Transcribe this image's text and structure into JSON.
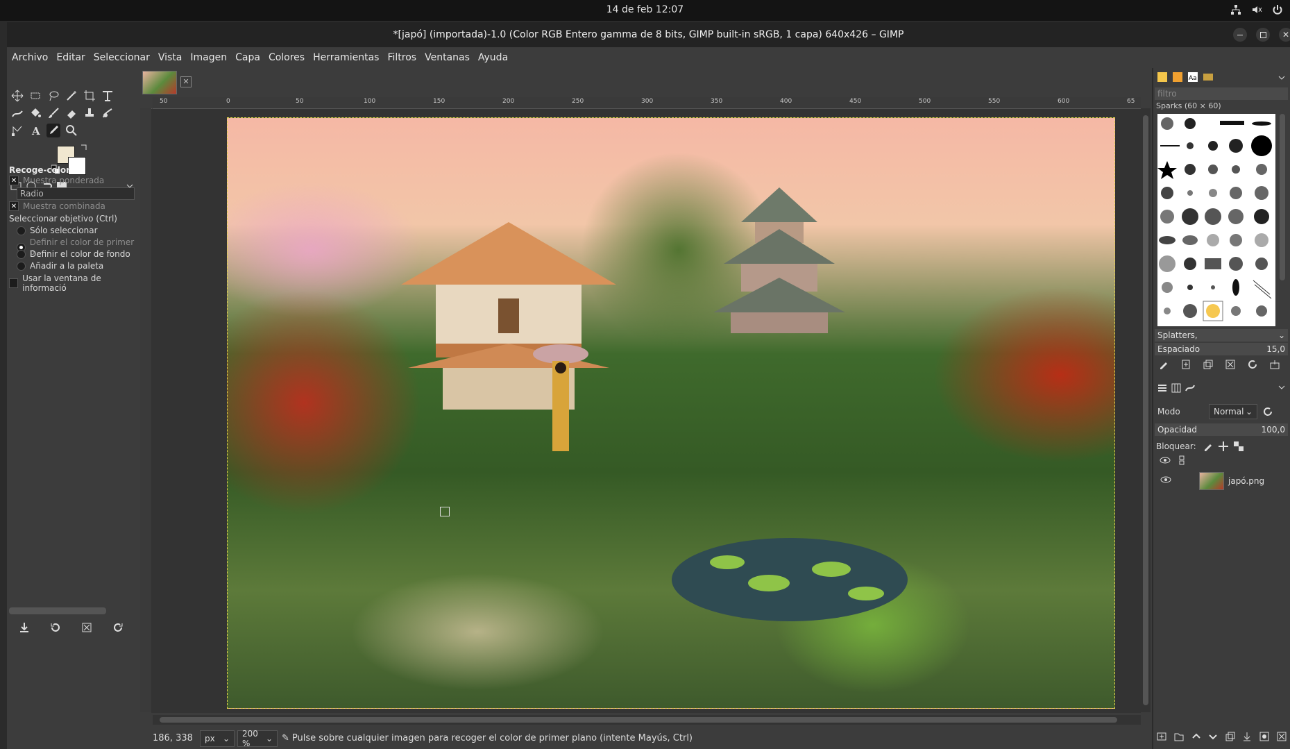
{
  "system": {
    "clock": "14 de feb  12:07"
  },
  "window": {
    "title": "*[japó] (importada)-1.0 (Color RGB Entero gamma de 8 bits, GIMP built-in sRGB, 1 capa) 640x426 – GIMP"
  },
  "menu": [
    "Archivo",
    "Editar",
    "Seleccionar",
    "Vista",
    "Imagen",
    "Capa",
    "Colores",
    "Herramientas",
    "Filtros",
    "Ventanas",
    "Ayuda"
  ],
  "colors": {
    "foreground": "#f0e7d0",
    "background": "#ffffff",
    "selection": "#e3d24a"
  },
  "tool_options": {
    "title": "Recoge-color",
    "sample_average": "Muestra ponderada",
    "radius_label": "Radio",
    "sample_merged": "Muestra combinada",
    "pick_target": "Seleccionar objetivo  (Ctrl)",
    "targets": [
      "Sólo seleccionar",
      "Definir el color de primer p",
      "Definir el color de fondo",
      "Añadir a la paleta"
    ],
    "use_info_window": "Usar la ventana de informació"
  },
  "ruler": {
    "labels": [
      "50",
      "0",
      "50",
      "100",
      "150",
      "200",
      "250",
      "300",
      "350",
      "400",
      "450",
      "500",
      "550",
      "600",
      "65"
    ]
  },
  "status": {
    "coords": "186, 338",
    "unit": "px",
    "zoom": "200 %",
    "message": "Pulse sobre cualquier imagen para recoger el color de primer plano (intente Mayús, Ctrl)"
  },
  "brushes": {
    "filter_placeholder": "filtro",
    "header": "Sparks (60 × 60)",
    "tag": "Splatters,",
    "spacing_label": "Espaciado",
    "spacing_value": "15,0"
  },
  "layers": {
    "mode_label": "Modo",
    "mode_value": "Normal",
    "opacity_label": "Opacidad",
    "opacity_value": "100,0",
    "lock_label": "Bloquear:",
    "items": [
      {
        "name": "japó.png"
      }
    ]
  }
}
